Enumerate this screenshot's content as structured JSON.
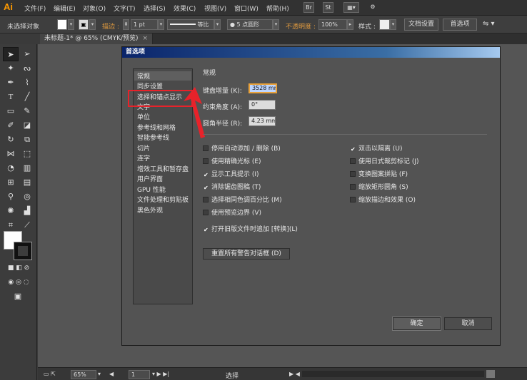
{
  "app": {
    "logo": "Ai"
  },
  "menu": [
    "文件(F)",
    "编辑(E)",
    "对象(O)",
    "文字(T)",
    "选择(S)",
    "效果(C)",
    "视图(V)",
    "窗口(W)",
    "帮助(H)"
  ],
  "menubar_buttons": {
    "bridge": "Br",
    "stock": "St"
  },
  "control_bar": {
    "no_selection": "未选择对象",
    "stroke_label": "描边 :",
    "stroke_width": "1 pt",
    "profile": "等比",
    "brush": "5 点圆形",
    "opacity_label": "不透明度 :",
    "opacity": "100%",
    "style_label": "样式 :",
    "doc_setup": "文档设置",
    "prefs": "首选项"
  },
  "document_tab": {
    "title": "未标题-1* @ 65% (CMYK/预览)",
    "close": "×"
  },
  "status_bar": {
    "zoom": "65%",
    "artboard": "1",
    "mode": "选择"
  },
  "dialog": {
    "title": "首选项",
    "nav_items": [
      "常规",
      "同步设置",
      "选择和锚点显示",
      "文字",
      "单位",
      "参考线和网格",
      "智能参考线",
      "切片",
      "连字",
      "增效工具和暂存盘",
      "用户界面",
      "GPU 性能",
      "文件处理和剪贴板",
      "黑色外观"
    ],
    "selected_nav": "常规",
    "highlighted_nav": "选择和锚点显示",
    "section_title": "常规",
    "fields": {
      "keyboard_increment": {
        "label": "键盘增量 (K):",
        "value": "3528 mm"
      },
      "constrain_angle": {
        "label": "约束角度 (A):",
        "value": "0°"
      },
      "corner_radius": {
        "label": "圆角半径 (R):",
        "value": "4.23 mm"
      }
    },
    "checkboxes_left": [
      {
        "label": "停用自动添加 / 删除 (B)",
        "checked": false
      },
      {
        "label": "使用精确光标 (E)",
        "checked": false
      },
      {
        "label": "显示工具提示 (I)",
        "checked": true
      },
      {
        "label": "消除锯齿图稿 (T)",
        "checked": true
      },
      {
        "label": "选择相同色调百分比 (M)",
        "checked": false
      },
      {
        "label": "使用预览边界 (V)",
        "checked": false
      },
      {
        "label": "打开旧版文件时追加 [转换](L)",
        "checked": true
      }
    ],
    "checkboxes_right": [
      {
        "label": "双击以隔离 (U)",
        "checked": true
      },
      {
        "label": "使用日式裁剪标记 (J)",
        "checked": false
      },
      {
        "label": "变换图案拼贴 (F)",
        "checked": false
      },
      {
        "label": "缩放矩形圆角 (S)",
        "checked": false
      },
      {
        "label": "缩放描边和效果 (O)",
        "checked": false
      }
    ],
    "reset_warnings": "重置所有警告对话框 (D)",
    "ok": "确定",
    "cancel": "取消"
  },
  "colors": {
    "highlight": "#e8222a",
    "titlebar": "#0a246a",
    "accent": "#ff9a00"
  }
}
